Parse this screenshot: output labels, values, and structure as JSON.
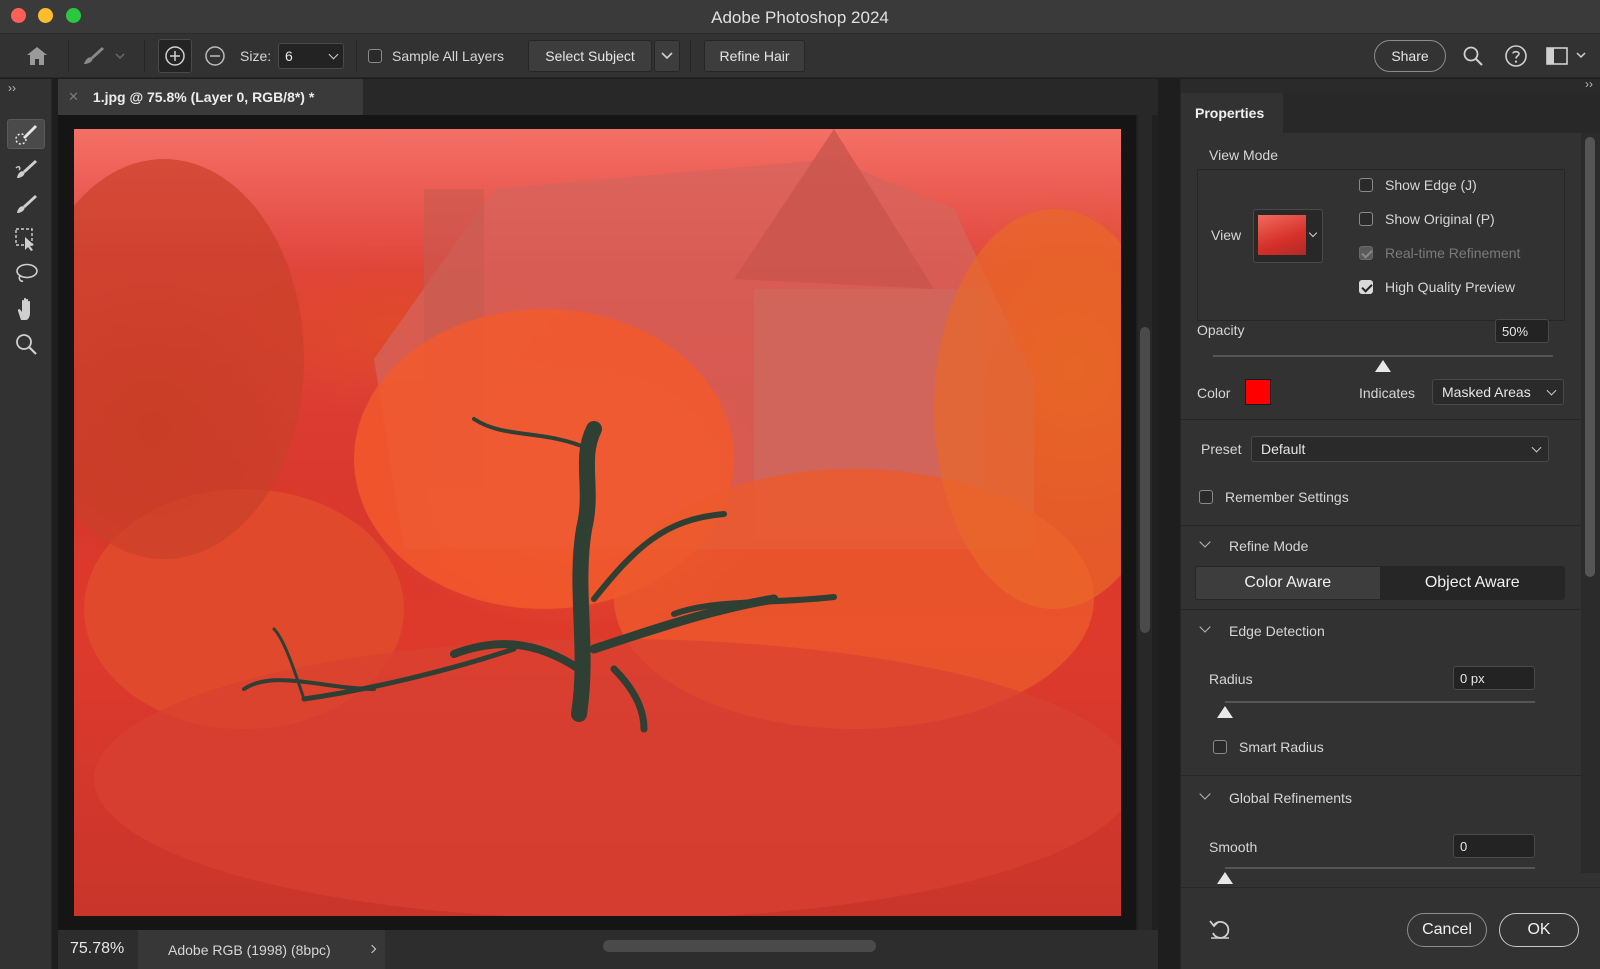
{
  "window": {
    "title": "Adobe Photoshop 2024"
  },
  "options_bar": {
    "size_label": "Size:",
    "size_value": "6",
    "sample_all_layers": "Sample All Layers",
    "select_subject": "Select Subject",
    "refine_hair": "Refine Hair",
    "share": "Share"
  },
  "document": {
    "tab_title": "1.jpg @ 75.8% (Layer 0, RGB/8*) *",
    "zoom": "75.78%",
    "color_profile": "Adobe RGB (1998) (8bpc)"
  },
  "properties": {
    "tab": "Properties",
    "view_mode": {
      "title": "View Mode",
      "view_label": "View",
      "show_edge": {
        "label": "Show Edge (J)",
        "checked": false
      },
      "show_original": {
        "label": "Show Original (P)",
        "checked": false
      },
      "realtime_refinement": {
        "label": "Real-time Refinement",
        "checked": true,
        "disabled": true
      },
      "high_quality_preview": {
        "label": "High Quality Preview",
        "checked": true
      }
    },
    "opacity": {
      "label": "Opacity",
      "value": "50%",
      "fraction": 0.5
    },
    "color": {
      "label": "Color",
      "swatch": "#ff0000"
    },
    "indicates": {
      "label": "Indicates",
      "value": "Masked Areas"
    },
    "preset": {
      "label": "Preset",
      "value": "Default"
    },
    "remember_settings": {
      "label": "Remember Settings",
      "checked": false
    },
    "refine_mode": {
      "title": "Refine Mode",
      "options": [
        "Color Aware",
        "Object Aware"
      ],
      "selected": "Color Aware"
    },
    "edge_detection": {
      "title": "Edge Detection",
      "radius_label": "Radius",
      "radius_value": "0 px",
      "radius_fraction": 0,
      "smart_radius": {
        "label": "Smart Radius",
        "checked": false
      }
    },
    "global_refinements": {
      "title": "Global Refinements",
      "smooth_label": "Smooth",
      "smooth_value": "0",
      "smooth_fraction": 0
    },
    "buttons": {
      "cancel": "Cancel",
      "ok": "OK"
    }
  },
  "tools": [
    "quick-selection-icon",
    "refine-edge-brush-icon",
    "brush-icon",
    "object-selection-icon",
    "lasso-icon",
    "hand-icon",
    "zoom-icon"
  ]
}
